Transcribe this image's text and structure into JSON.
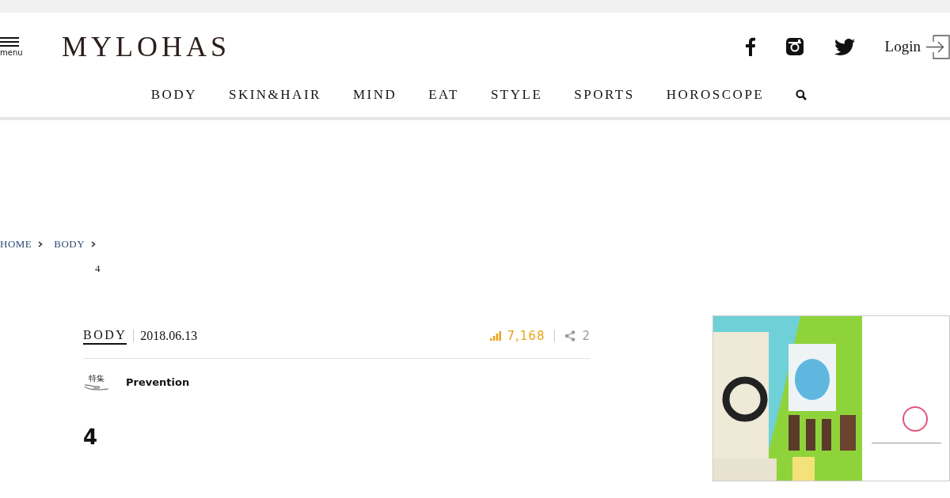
{
  "header": {
    "menu_label": "menu",
    "logo": "MYLOHAS",
    "login": "Login"
  },
  "nav": [
    {
      "label": "BODY"
    },
    {
      "label": "SKIN&HAIR"
    },
    {
      "label": "MIND"
    },
    {
      "label": "EAT"
    },
    {
      "label": "STYLE"
    },
    {
      "label": "SPORTS"
    },
    {
      "label": "HOROSCOPE"
    }
  ],
  "breadcrumb": [
    {
      "label": "HOME"
    },
    {
      "label": "BODY"
    }
  ],
  "breadcrumb_current": "4",
  "article": {
    "category": "BODY",
    "date": "2018.06.13",
    "views": "7,168",
    "shares": "2",
    "feature_label": "特集",
    "feature": "Prevention",
    "title": "4"
  }
}
